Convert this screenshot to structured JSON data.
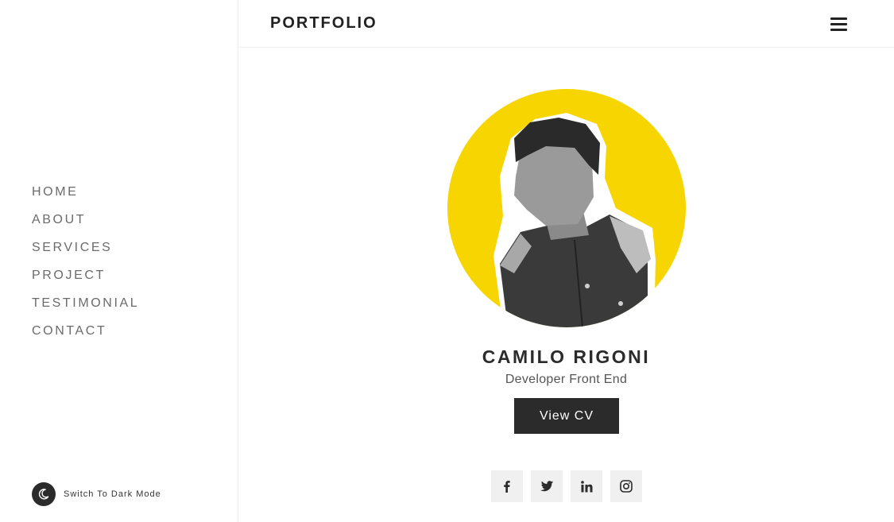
{
  "sidebar": {
    "nav": [
      "HOME",
      "ABOUT",
      "SERVICES",
      "PROJECT",
      "TESTIMONIAL",
      "CONTACT"
    ],
    "dark_mode_label": "Switch To Dark Mode"
  },
  "header": {
    "brand": "PORTFOLIO"
  },
  "hero": {
    "name": "CAMILO RIGONI",
    "role": "Developer Front End",
    "cv_button": "View CV",
    "avatar_bg": "#f7d500"
  },
  "socials": [
    "facebook-icon",
    "twitter-icon",
    "linkedin-icon",
    "instagram-icon"
  ]
}
